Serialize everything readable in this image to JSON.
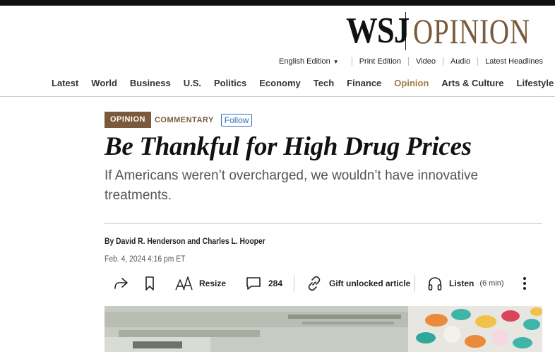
{
  "masthead": {
    "wsj": "WSJ",
    "section": "OPINION"
  },
  "utility": {
    "edition": "English Edition",
    "links": [
      "Print Edition",
      "Video",
      "Audio",
      "Latest Headlines"
    ]
  },
  "nav": {
    "items": [
      "Latest",
      "World",
      "Business",
      "U.S.",
      "Politics",
      "Economy",
      "Tech",
      "Finance",
      "Opinion",
      "Arts & Culture",
      "Lifestyle"
    ],
    "active": "Opinion"
  },
  "article": {
    "tag_primary": "OPINION",
    "tag_secondary": "COMMENTARY",
    "follow_label": "Follow",
    "headline": "Be Thankful for High Drug Prices",
    "dek": "If Americans weren’t overcharged, we wouldn’t have innovative treatments.",
    "byline": "By David R. Henderson and Charles L. Hooper",
    "date": "Feb. 4, 2024 4:16 pm ET"
  },
  "toolbar": {
    "resize_label": "Resize",
    "comments_count": "284",
    "gift_label": "Gift unlocked article",
    "listen_label": "Listen",
    "listen_duration": "(6 min)"
  },
  "colors": {
    "opinion_brown": "#7a5a3a",
    "nav_active": "#a07a42",
    "follow_blue": "#2e6fb7"
  }
}
